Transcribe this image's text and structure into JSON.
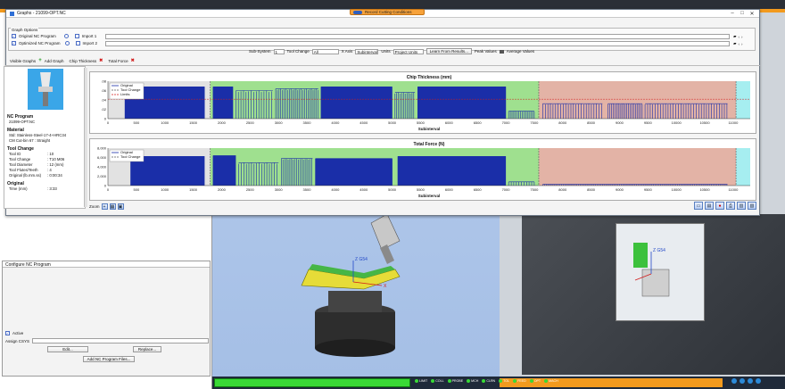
{
  "window": {
    "title": "Graphs - 21099-OPT.NC"
  },
  "record_button": {
    "label": "Record Cutting Conditions"
  },
  "graph_options": {
    "label": "Graph Options",
    "original_program": "Original NC Program",
    "optimized_program": "Optimized NC Program",
    "import1": "Import 1",
    "import2": "Import 2",
    "visible_graphs_label": "Visible Graphs",
    "add_graph": "Add Graph",
    "chip_thickness": "Chip Thickness",
    "total_force": "Total Force",
    "subsystem_label": "Sub-System",
    "subsystem_value": "1",
    "tool_change_label": "Tool Change",
    "tool_change_value": "All",
    "xaxis_label": "X Axis",
    "xaxis_value": "Subinterval",
    "units_label": "Units",
    "units_value": "Project Units",
    "learn_button": "Learn From Results...",
    "peak_values": "Peak Values",
    "average_values": "Average Values"
  },
  "sidebar": {
    "nc_program_title": "NC Program",
    "nc_program_value": "21099-OPT.NC",
    "material_title": "Material",
    "material_std": "Std: Stainless-Steel-17-4+HRC34",
    "material_cut": "CM Cut-bin 67 : Straight",
    "tool_change_title": "Tool Change",
    "tool_rows": [
      {
        "k": "Tool ID",
        "v": ": 10"
      },
      {
        "k": "Tool Change",
        "v": ": T10 M06"
      },
      {
        "k": "Tool Diameter",
        "v": ": 12 (mm)"
      },
      {
        "k": "Tool Flutes/Teeth",
        "v": ": 4"
      },
      {
        "k": "Original (lb.mm.ss)",
        "v": ": 0:00:34"
      }
    ],
    "original_title": "Original",
    "original_time_label": "Time (mm)",
    "original_time_value": ": 3:33"
  },
  "zoom": {
    "label": "Zoom"
  },
  "configure_panel": {
    "title": "Configure NC Program",
    "active_label": "Active",
    "assign_label": "Assign CSYS",
    "edit_button": "Edit...",
    "replace_button": "Replace...",
    "add_button": "Add NC Program Files..."
  },
  "scene": {
    "axis_label": "Z G54",
    "axis_x": "X",
    "machine_label": "Z G54"
  },
  "bottom_bar": {
    "items": [
      "LIMIT",
      "COLL",
      "PROBE",
      "MCH",
      "CLRN",
      "TOL",
      "FEED",
      "OPT",
      "MACH"
    ]
  },
  "colors": {
    "original_series": "#1a2ea8",
    "tool_change": "#5a5a5a",
    "limits": "#d21b1b",
    "green_band": "#9fe08f",
    "salmon_band": "#e3b3a6",
    "cyan_band": "#a6eef0"
  },
  "chart_data": [
    {
      "type": "line",
      "title": "Chip Thickness (mm)",
      "xlabel": "Subinterval",
      "ylabel": "",
      "xlim": [
        0,
        11300
      ],
      "ylim": [
        0,
        0.1
      ],
      "yticks": [
        ".08",
        ".06",
        ".04",
        ".02",
        "0"
      ],
      "xticks": [
        0,
        500,
        1000,
        1500,
        2000,
        2500,
        3000,
        3500,
        4000,
        4500,
        5000,
        5500,
        6000,
        6500,
        7000,
        7500,
        8000,
        8500,
        9000,
        9500,
        10000,
        10500,
        11000
      ],
      "legend": [
        "Original",
        "Tool Change",
        "Limits"
      ],
      "legend_position": "top-left",
      "limit_value": 0.052,
      "bands": [
        {
          "from": 0,
          "to": 1800,
          "color": "gray"
        },
        {
          "from": 1800,
          "to": 7580,
          "color": "green"
        },
        {
          "from": 7580,
          "to": 11050,
          "color": "salmon"
        },
        {
          "from": 11050,
          "to": 11300,
          "color": "cyan"
        }
      ],
      "tool_changes": [
        1800,
        7580,
        11050
      ],
      "segments": [
        {
          "from": 300,
          "to": 1700,
          "level": 0.085,
          "dense": true
        },
        {
          "from": 1850,
          "to": 2200,
          "level": 0.085,
          "dense": true
        },
        {
          "from": 2250,
          "to": 2900,
          "level": 0.075,
          "dense": false
        },
        {
          "from": 2950,
          "to": 3700,
          "level": 0.08,
          "dense": false
        },
        {
          "from": 3750,
          "to": 5000,
          "level": 0.085,
          "dense": true
        },
        {
          "from": 5050,
          "to": 5400,
          "level": 0.07,
          "dense": false
        },
        {
          "from": 5450,
          "to": 7000,
          "level": 0.085,
          "dense": true
        },
        {
          "from": 7050,
          "to": 7500,
          "level": 0.02,
          "dense": false
        },
        {
          "from": 7650,
          "to": 8700,
          "level": 0.04,
          "dense": false
        },
        {
          "from": 8800,
          "to": 9400,
          "level": 0.04,
          "dense": false
        },
        {
          "from": 9450,
          "to": 10900,
          "level": 0.04,
          "dense": false
        }
      ]
    },
    {
      "type": "line",
      "title": "Total Force (N)",
      "xlabel": "Subinterval",
      "ylabel": "",
      "xlim": [
        0,
        11300
      ],
      "ylim": [
        0,
        9000
      ],
      "yticks": [
        "8,000",
        "6,000",
        "4,000",
        "2,000",
        "0"
      ],
      "xticks": [
        0,
        500,
        1000,
        1500,
        2000,
        2500,
        3000,
        3500,
        4000,
        4500,
        5000,
        5500,
        6000,
        6500,
        7000,
        7500,
        8000,
        8500,
        9000,
        9500,
        10000,
        10500,
        11000
      ],
      "legend": [
        "Original",
        "Tool Change"
      ],
      "legend_position": "top-left",
      "bands": [
        {
          "from": 0,
          "to": 1800,
          "color": "gray"
        },
        {
          "from": 1800,
          "to": 7580,
          "color": "green"
        },
        {
          "from": 7580,
          "to": 11050,
          "color": "salmon"
        },
        {
          "from": 11050,
          "to": 11300,
          "color": "cyan"
        }
      ],
      "tool_changes": [
        1800,
        7580,
        11050
      ],
      "segments": [
        {
          "from": 400,
          "to": 1700,
          "level": 7000,
          "dense": true
        },
        {
          "from": 1850,
          "to": 2250,
          "level": 7200,
          "dense": true
        },
        {
          "from": 2300,
          "to": 3000,
          "level": 5500,
          "dense": false
        },
        {
          "from": 3050,
          "to": 3600,
          "level": 6500,
          "dense": false
        },
        {
          "from": 3650,
          "to": 5000,
          "level": 6500,
          "dense": true
        },
        {
          "from": 5100,
          "to": 7000,
          "level": 7000,
          "dense": true
        },
        {
          "from": 7050,
          "to": 7500,
          "level": 900,
          "dense": false
        },
        {
          "from": 7650,
          "to": 10900,
          "level": 300,
          "dense": false
        }
      ]
    }
  ]
}
